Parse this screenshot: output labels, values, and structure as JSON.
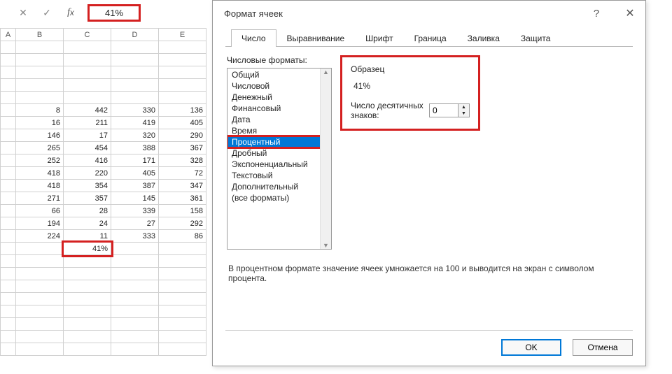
{
  "formula_bar": {
    "value": "41%"
  },
  "columns": [
    "A",
    "B",
    "C",
    "D",
    "E"
  ],
  "rows": [
    [
      "",
      "",
      "",
      "",
      ""
    ],
    [
      "",
      "",
      "",
      "",
      ""
    ],
    [
      "",
      "",
      "",
      "",
      ""
    ],
    [
      "",
      "",
      "",
      "",
      ""
    ],
    [
      "",
      "",
      "",
      "",
      ""
    ],
    [
      "",
      "8",
      "442",
      "330",
      "136"
    ],
    [
      "",
      "16",
      "211",
      "419",
      "405"
    ],
    [
      "",
      "146",
      "17",
      "320",
      "290"
    ],
    [
      "",
      "265",
      "454",
      "388",
      "367"
    ],
    [
      "",
      "252",
      "416",
      "171",
      "328"
    ],
    [
      "",
      "418",
      "220",
      "405",
      "72"
    ],
    [
      "",
      "418",
      "354",
      "387",
      "347"
    ],
    [
      "",
      "271",
      "357",
      "145",
      "361"
    ],
    [
      "",
      "66",
      "28",
      "339",
      "158"
    ],
    [
      "",
      "194",
      "24",
      "27",
      "292"
    ],
    [
      "",
      "224",
      "11",
      "333",
      "86"
    ],
    [
      "",
      "",
      "41%",
      "",
      ""
    ],
    [
      "",
      "",
      "",
      "",
      ""
    ],
    [
      "",
      "",
      "",
      "",
      ""
    ],
    [
      "",
      "",
      "",
      "",
      ""
    ],
    [
      "",
      "",
      "",
      "",
      ""
    ],
    [
      "",
      "",
      "",
      "",
      ""
    ],
    [
      "",
      "",
      "",
      "",
      ""
    ],
    [
      "",
      "",
      "",
      "",
      ""
    ],
    [
      "",
      "",
      "",
      "",
      ""
    ]
  ],
  "selected_cell": {
    "row": 16,
    "col": 2
  },
  "dialog": {
    "title": "Формат ячеек",
    "help": "?",
    "close": "✕",
    "tabs": [
      "Число",
      "Выравнивание",
      "Шрифт",
      "Граница",
      "Заливка",
      "Защита"
    ],
    "active_tab": 0,
    "formats_label": "Числовые форматы:",
    "formats": [
      "Общий",
      "Числовой",
      "Денежный",
      "Финансовый",
      "Дата",
      "Время",
      "Процентный",
      "Дробный",
      "Экспоненциальный",
      "Текстовый",
      "Дополнительный",
      "(все форматы)"
    ],
    "selected_format": 6,
    "sample_label": "Образец",
    "sample_value": "41%",
    "decimals_label": "Число десятичных знаков:",
    "decimals_value": "0",
    "hint": "В процентном формате значение ячеек умножается на 100 и выводится на экран с символом процента.",
    "ok": "OK",
    "cancel": "Отмена"
  }
}
